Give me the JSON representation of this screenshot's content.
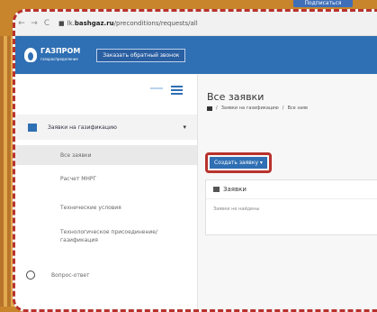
{
  "top_button": "Подписаться",
  "browser": {
    "url_prefix": "lk.",
    "url_host": "bashgaz.ru",
    "url_path": "/preconditions/requests/all"
  },
  "header": {
    "logo_text": "ГАЗПРОМ",
    "logo_sub": "газораспределение",
    "callback_label": "Заказать обратный звонок"
  },
  "sidebar": {
    "main_item": "Заявки на газификацию",
    "sub_items": [
      "Все заявки",
      "Расчет МНРГ",
      "Технические условия",
      "Технологическое присоединение/газификация"
    ],
    "bottom_item": "Вопрос-ответ"
  },
  "main": {
    "title": "Все заявки",
    "breadcrumb_1": "Заявки на газификацию",
    "breadcrumb_sep": "/",
    "breadcrumb_2": "Все заяв",
    "create_label": "Создать заявку ▾",
    "panel_title": "Заявки",
    "panel_empty": "Заявки не найдены"
  }
}
